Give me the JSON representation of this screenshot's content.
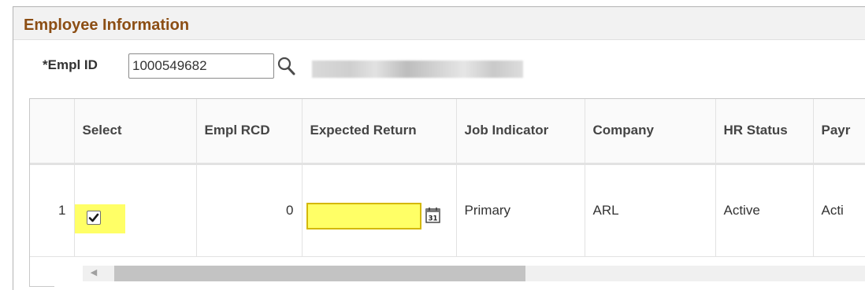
{
  "section": {
    "title": "Employee Information"
  },
  "empl_id": {
    "label": "*Empl ID",
    "value": "1000549682"
  },
  "grid": {
    "columns": {
      "row_num": "",
      "select": "Select",
      "empl_rcd": "Empl RCD",
      "expected_return": "Expected Return",
      "job_indicator": "Job Indicator",
      "company": "Company",
      "hr_status": "HR Status",
      "payroll_status": "Payr"
    },
    "rows": [
      {
        "row_num": "1",
        "select_checked": true,
        "empl_rcd": "0",
        "expected_return": "",
        "job_indicator": "Primary",
        "company": "ARL",
        "hr_status": "Active",
        "payroll_status": "Acti"
      }
    ]
  },
  "colors": {
    "section_title": "#8c4e14",
    "highlight": "#ffff66",
    "highlight_border": "#d4b800"
  },
  "icons": {
    "search": "magnifier-icon",
    "calendar": "calendar-icon",
    "check": "checkmark-icon",
    "scroll_left": "triangle-left-icon"
  }
}
